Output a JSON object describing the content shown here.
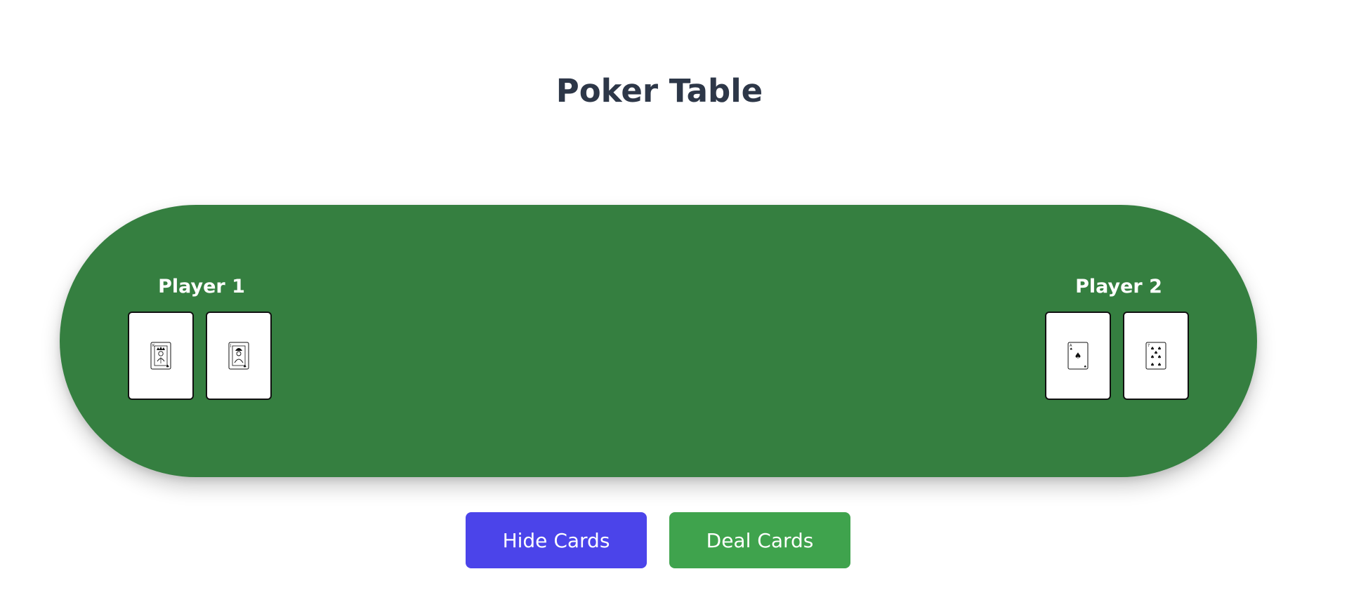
{
  "page": {
    "title": "Poker Table"
  },
  "players": [
    {
      "name": "Player 1",
      "cards": [
        {
          "rank": "K",
          "suit": "spades",
          "suit_symbol": "♠",
          "kind": "face-king"
        },
        {
          "rank": "J",
          "suit": "spades",
          "suit_symbol": "♠",
          "kind": "face-jack"
        }
      ]
    },
    {
      "name": "Player 2",
      "cards": [
        {
          "rank": "A",
          "suit": "spades",
          "suit_symbol": "♠",
          "kind": "ace"
        },
        {
          "rank": "7",
          "suit": "spades",
          "suit_symbol": "♠",
          "kind": "pips"
        }
      ]
    }
  ],
  "controls": {
    "hide_label": "Hide Cards",
    "deal_label": "Deal Cards"
  },
  "colors": {
    "title": "#2d3748",
    "table_felt": "#357f40",
    "hide_button": "#4b44ea",
    "deal_button": "#3fa34d",
    "card_face": "#ffffff",
    "card_border": "#111111"
  },
  "icons": {
    "card_king": "king-of-spades-icon",
    "card_jack": "jack-of-spades-icon",
    "card_ace": "ace-of-spades-icon",
    "card_seven": "seven-of-spades-icon"
  }
}
